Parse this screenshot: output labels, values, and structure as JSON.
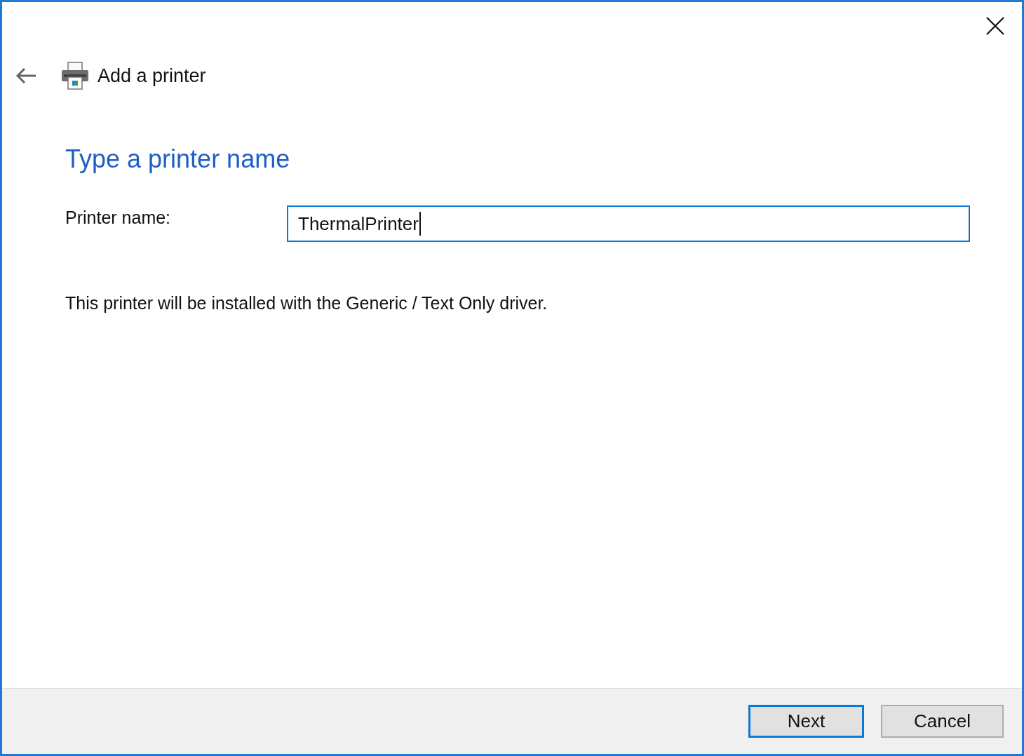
{
  "header": {
    "title": "Add a printer"
  },
  "page": {
    "heading": "Type a printer name",
    "field": {
      "label": "Printer name:",
      "value": "ThermalPrinter",
      "focused": true
    },
    "note": "This printer will be installed with the Generic / Text Only driver."
  },
  "buttons": [
    {
      "label": "Next",
      "default": true
    },
    {
      "label": "Cancel",
      "default": false
    }
  ]
}
